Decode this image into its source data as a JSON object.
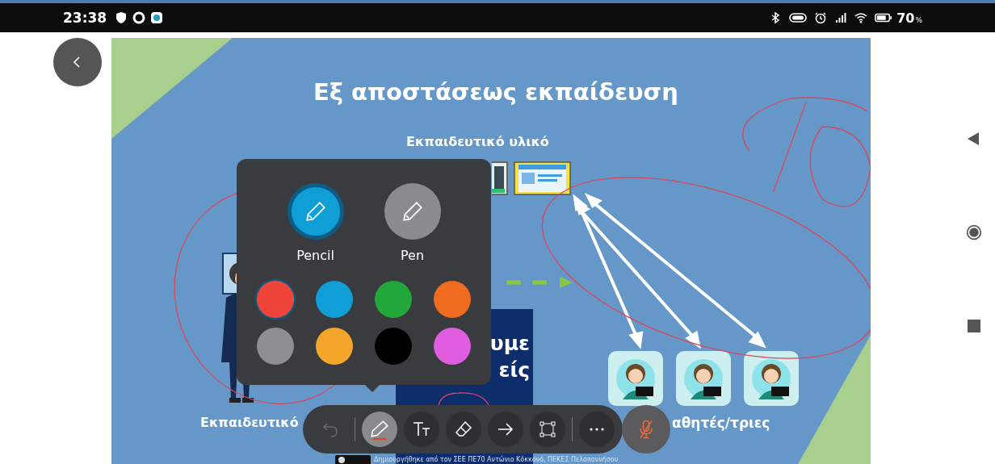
{
  "status_bar": {
    "time": "23:38",
    "battery_text": "70",
    "battery_unit": "%"
  },
  "slide": {
    "title": "Εξ αποστάσεως εκπαίδευση",
    "subtitle": "Εκπαιδευτικό υλικό",
    "teacher_label": "Εκπαιδευτικό",
    "students_label": "αθητές/τριες",
    "card_lines": [
      "υμε",
      "είς"
    ],
    "footer": "Δημιουργήθηκε από τον ΣΕΕ ΠΕ70 Αντώνιο Κόκκονό, ΠΕΚΕΣ Πελοποννήσου"
  },
  "pen_popup": {
    "tools": [
      {
        "label": "Pencil",
        "selected": true
      },
      {
        "label": "Pen",
        "selected": false
      }
    ],
    "colors": [
      {
        "color": "#f0453a",
        "selected": true
      },
      {
        "color": "#109ed6",
        "selected": false
      },
      {
        "color": "#22a83a",
        "selected": false
      },
      {
        "color": "#ef6b1f",
        "selected": false
      },
      {
        "color": "#8e8f91",
        "selected": false
      },
      {
        "color": "#f3a62a",
        "selected": false
      },
      {
        "color": "#000000",
        "selected": false
      },
      {
        "color": "#e05ddf",
        "selected": false
      }
    ]
  },
  "toolbar": {
    "tools": [
      {
        "kind": "undo",
        "selected": false,
        "disabled": true
      },
      {
        "kind": "pencil",
        "selected": true,
        "disabled": false
      },
      {
        "kind": "text",
        "selected": false,
        "disabled": false
      },
      {
        "kind": "eraser",
        "selected": false,
        "disabled": false
      },
      {
        "kind": "arrow",
        "selected": false,
        "disabled": false
      },
      {
        "kind": "shape",
        "selected": false,
        "disabled": false
      },
      {
        "kind": "more",
        "selected": false,
        "disabled": false
      }
    ],
    "mic_muted": true
  }
}
